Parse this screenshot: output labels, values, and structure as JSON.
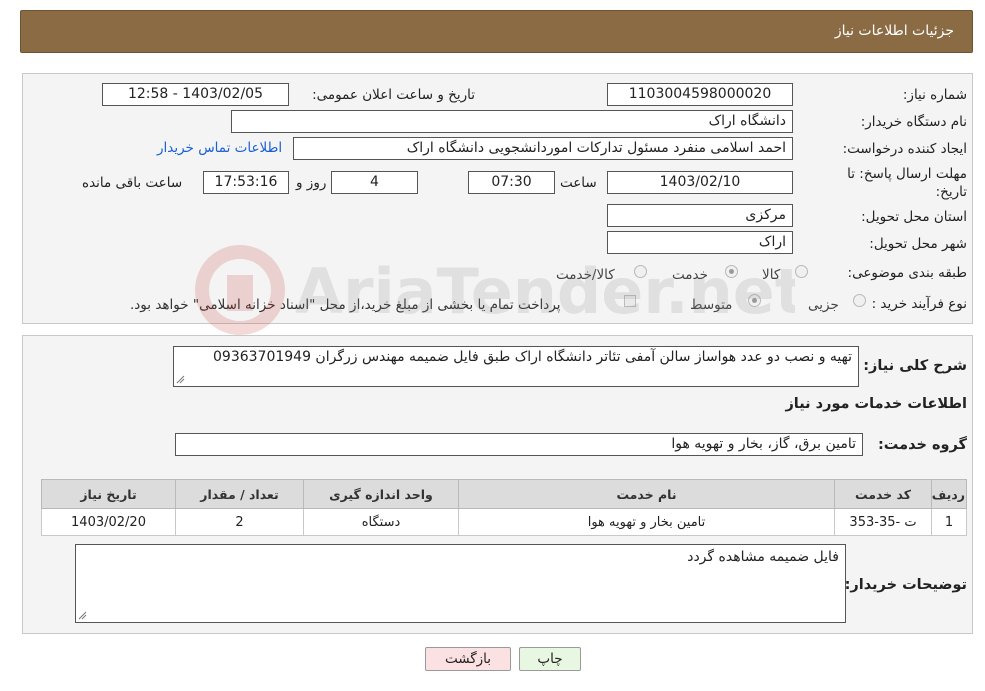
{
  "title": "جزئیات اطلاعات نیاز",
  "fields": {
    "need_number_label": "شماره نیاز:",
    "need_number": "1103004598000020",
    "announce_label": "تاریخ و ساعت اعلان عمومی:",
    "announce_value": "1403/02/05 - 12:58",
    "buyer_org_label": "نام دستگاه خریدار:",
    "buyer_org": "دانشگاه اراک",
    "creator_label": "ایجاد کننده درخواست:",
    "creator": "احمد  اسلامی منفرد مسئول تدارکات اموردانشجویی دانشگاه اراک",
    "contact_link": "اطلاعات تماس خریدار",
    "deadline_label": "مهلت ارسال پاسخ: تا تاریخ:",
    "deadline_date": "1403/02/10",
    "time_label": "ساعت",
    "deadline_time": "07:30",
    "days_value": "4",
    "days_label": "روز و",
    "remaining_time": "17:53:16",
    "remaining_label": "ساعت باقی مانده",
    "province_label": "استان محل تحویل:",
    "province": "مرکزی",
    "city_label": "شهر محل تحویل:",
    "city": "اراک",
    "category_label": "طبقه بندی موضوعی:",
    "category_options": [
      "کالا",
      "خدمت",
      "کالا/خدمت"
    ],
    "purchase_type_label": "نوع فرآیند خرید :",
    "purchase_options": [
      "جزیی",
      "متوسط"
    ],
    "purchase_note": "پرداخت تمام یا بخشی از مبلغ خرید،از محل \"اسناد خزانه اسلامی\" خواهد بود."
  },
  "description": {
    "label": "شرح کلی نیاز:",
    "value": "تهیه و نصب دو عدد هواساز سالن آمفی تئاتر دانشگاه اراک طبق فایل ضمیمه مهندس زرگران 09363701949"
  },
  "services": {
    "section_title": "اطلاعات خدمات مورد نیاز",
    "group_label": "گروه خدمت:",
    "group_value": "تامین برق، گاز، بخار و تهویه هوا",
    "columns": [
      "ردیف",
      "کد خدمت",
      "نام خدمت",
      "واحد اندازه گیری",
      "تعداد / مقدار",
      "تاریخ نیاز"
    ],
    "rows": [
      [
        "1",
        "ت -35-353",
        "تامین بخار و تهویه هوا",
        "دستگاه",
        "2",
        "1403/02/20"
      ]
    ]
  },
  "buyer_notes": {
    "label": "توضیحات خریدار:",
    "value": "فایل ضمیمه مشاهده گردد"
  },
  "buttons": {
    "print": "چاپ",
    "back": "بازگشت"
  },
  "watermark": "AriaTender.net",
  "colors": {
    "titlebar": "#8b6b44",
    "link": "#1a5fd6",
    "print_button": "#e8f7e1",
    "back_button": "#fbe1e1"
  }
}
